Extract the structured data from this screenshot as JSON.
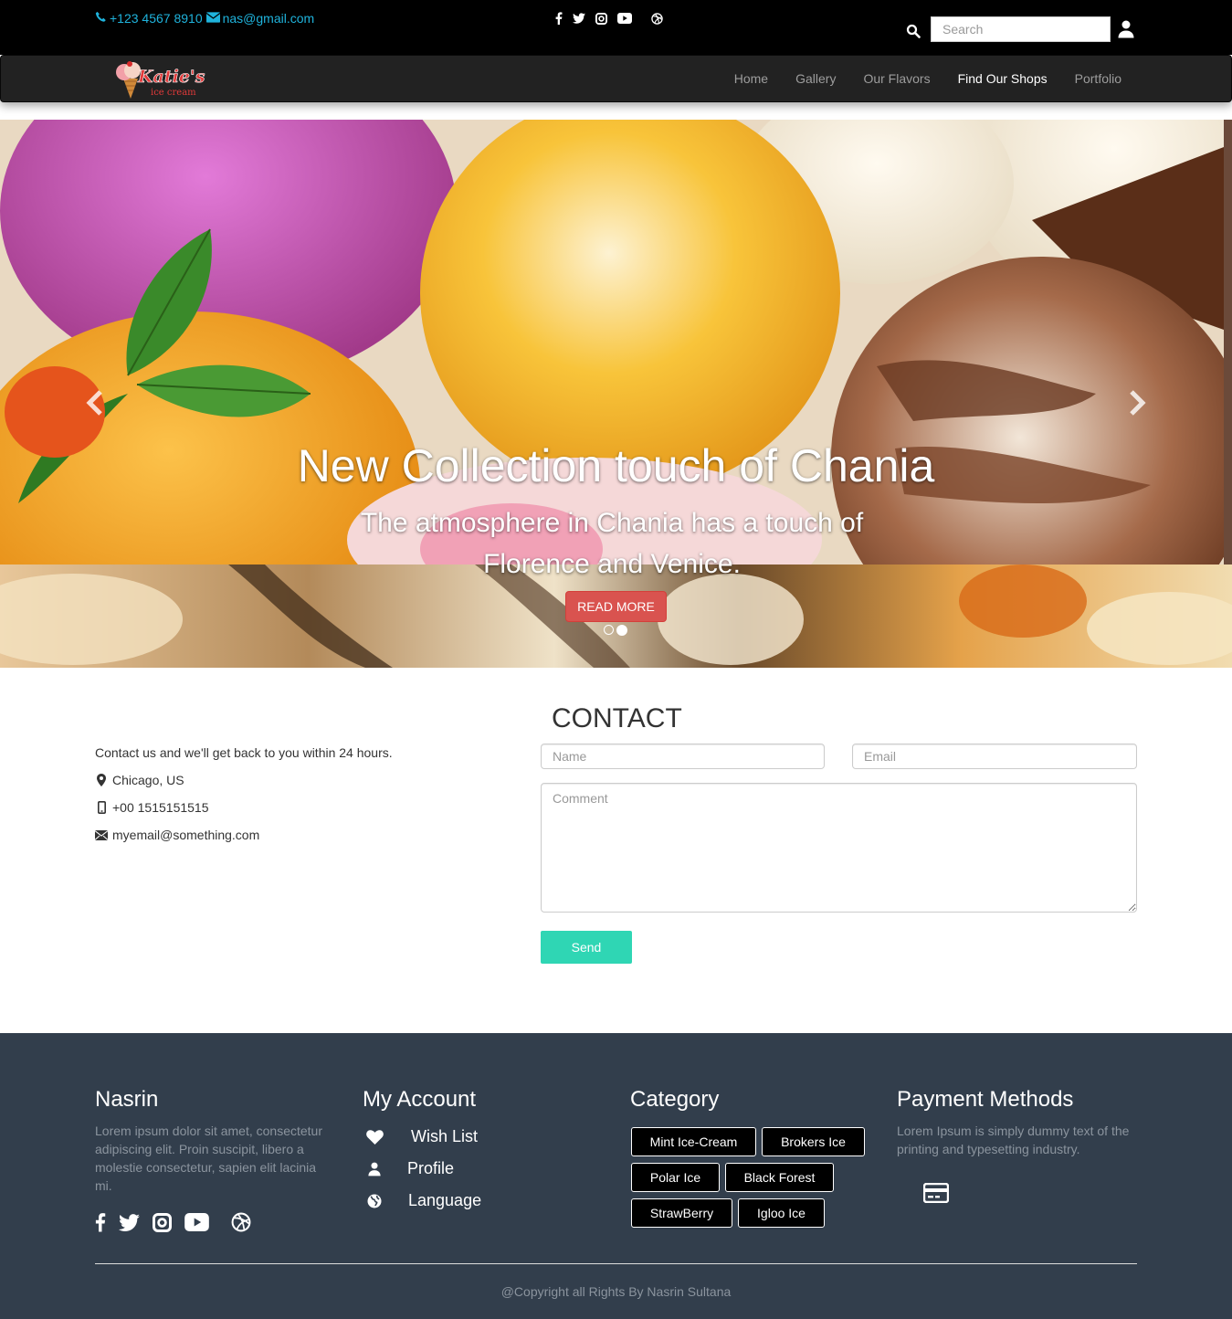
{
  "topbar": {
    "phone": "+123 4567 8910",
    "email": "nas@gmail.com",
    "social": [
      "facebook-icon",
      "twitter-icon",
      "instagram-icon",
      "youtube-icon",
      "dribbble-icon"
    ],
    "search_placeholder": "Search"
  },
  "navbar": {
    "logo_text": "Katie's",
    "logo_sub": "ice cream",
    "links": [
      "Home",
      "Gallery",
      "Our Flavors",
      "Find Our Shops",
      "Portfolio"
    ],
    "active_index": 3
  },
  "hero": {
    "title": "New Collection touch of Chania",
    "subtitle": "The atmosphere in Chania has a touch of Florence and Venice.",
    "cta": "READ MORE",
    "slide_count": 2,
    "active_slide": 1
  },
  "contact": {
    "title": "CONTACT",
    "intro": "Contact us and we'll get back to you within 24 hours.",
    "location": "Chicago, US",
    "phone": "+00 1515151515",
    "email": "myemail@something.com",
    "name_placeholder": "Name",
    "email_placeholder": "Email",
    "comment_placeholder": "Comment",
    "send_label": "Send"
  },
  "footer": {
    "about": {
      "title": "Nasrin",
      "text": "Lorem ipsum dolor sit amet, consectetur adipiscing elit. Proin suscipit, libero a molestie consectetur, sapien elit lacinia mi."
    },
    "account": {
      "title": "My Account",
      "items": [
        {
          "label": "Wish List",
          "icon": "heart-icon"
        },
        {
          "label": "Profile",
          "icon": "user-icon"
        },
        {
          "label": "Language",
          "icon": "globe-icon"
        }
      ]
    },
    "category": {
      "title": "Category",
      "tags": [
        "Mint Ice-Cream",
        "Brokers Ice",
        "Polar Ice",
        "Black Forest",
        "StrawBerry",
        "Igloo Ice"
      ]
    },
    "payment": {
      "title": "Payment Methods",
      "text": "Lorem Ipsum is simply dummy text of the printing and typesetting industry.",
      "icon": "credit-card-icon"
    },
    "copyright": "@Copyright all Rights By Nasrin Sultana"
  },
  "colors": {
    "accent_blue": "#1fb3dc",
    "send_green": "#2fd6b4",
    "cta_red": "#d9534f",
    "footer_bg": "#323e4c"
  }
}
